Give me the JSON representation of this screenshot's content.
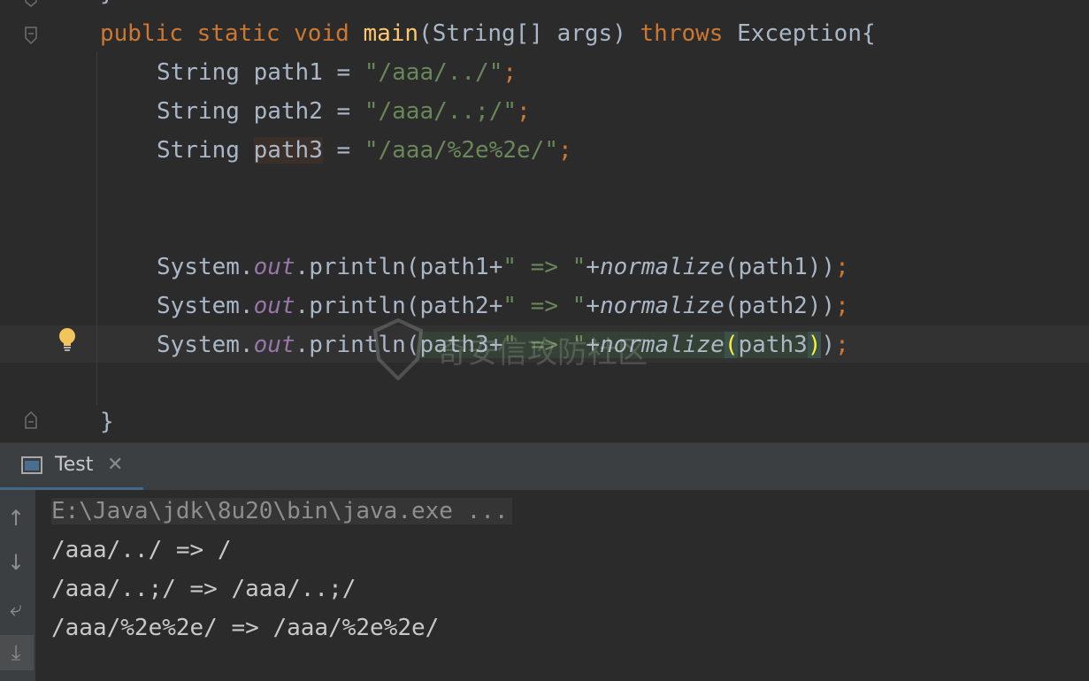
{
  "editor": {
    "lines": [
      {
        "id": "main_decl",
        "parts": {
          "public": "public",
          "static": "static",
          "void": "void",
          "name": "main",
          "params_open": "(String[] args) ",
          "throws": "throws",
          "exc": "Exception{"
        }
      },
      {
        "id": "decl1",
        "type": "String",
        "var": "path1",
        "eq": " = ",
        "value": "\"/aaa/../\"",
        "semi": ";"
      },
      {
        "id": "decl2",
        "type": "String",
        "var": "path2",
        "eq": " = ",
        "value": "\"/aaa/..;/\"",
        "semi": ";"
      },
      {
        "id": "decl3",
        "type": "String",
        "var": "path3",
        "eq": " = ",
        "value": "\"/aaa/%2e%2e/\"",
        "semi": ";"
      },
      {
        "id": "print1",
        "sys": "System.",
        "out": "out",
        "println": ".println(",
        "arg": "path1+",
        "sep": "\" => \"",
        "plus": "+",
        "norm": "normalize",
        "call": "(path1))",
        "semi": ";"
      },
      {
        "id": "print2",
        "sys": "System.",
        "out": "out",
        "println": ".println(",
        "arg": "path2+",
        "sep": "\" => \"",
        "plus": "+",
        "norm": "normalize",
        "call": "(path2))",
        "semi": ";"
      },
      {
        "id": "print3",
        "sys": "System.",
        "out": "out",
        "println": ".println(",
        "arg": "path3+",
        "sep": "\" => \"",
        "plus": "+",
        "norm": "normalize",
        "p_open": "(",
        "inner": "path3",
        "p_close": ")",
        "close": ")",
        "semi": ";"
      },
      {
        "id": "close",
        "text": "}"
      }
    ],
    "top_fragment": "}"
  },
  "watermark": {
    "text": "奇安信攻防社区"
  },
  "tool_window": {
    "tab_label": "Test",
    "close_glyph": "✕"
  },
  "console": {
    "command": "E:\\Java\\jdk\\8u20\\bin\\java.exe ...",
    "output": [
      "/aaa/../ => /",
      "/aaa/..;/ => /aaa/..;/",
      "/aaa/%2e%2e/ => /aaa/%2e%2e/"
    ],
    "side_buttons": [
      {
        "name": "up-arrow-icon",
        "glyph": "↑"
      },
      {
        "name": "down-arrow-icon",
        "glyph": "↓"
      },
      {
        "name": "soft-wrap-icon",
        "glyph": "⤶"
      },
      {
        "name": "scroll-to-end-icon",
        "glyph": "⤓"
      }
    ]
  },
  "colors": {
    "keyword": "#cc7832",
    "method": "#ffc66d",
    "string": "#6a8759",
    "field": "#9876aa",
    "text": "#a9b7c6",
    "background": "#2b2b2b"
  }
}
